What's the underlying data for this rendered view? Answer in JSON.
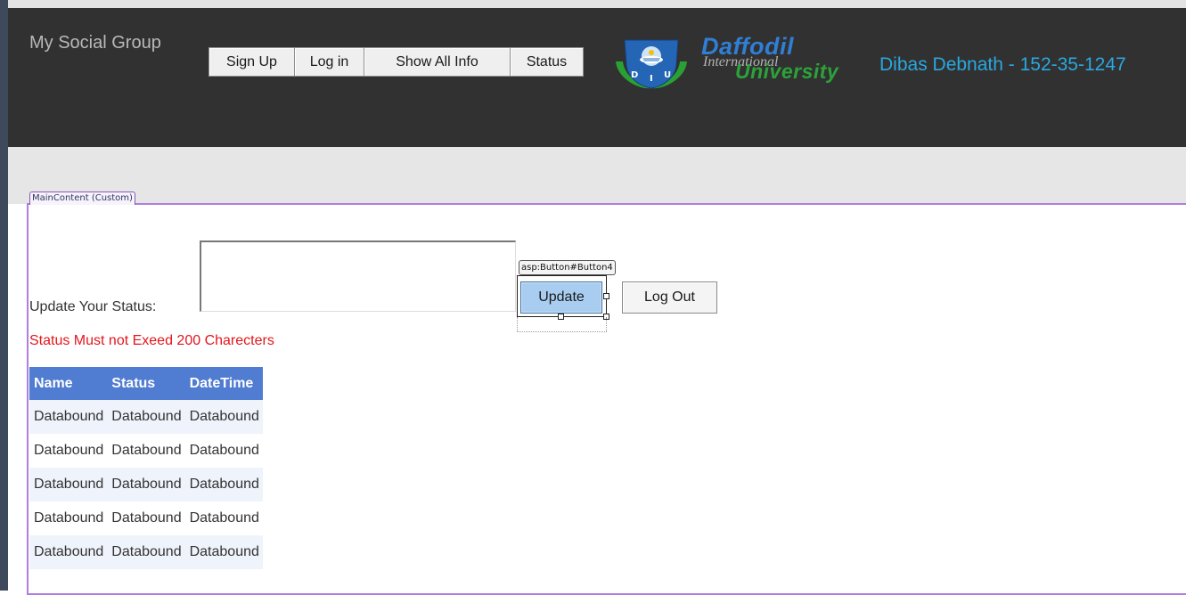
{
  "header": {
    "site_title": "My Social Group",
    "nav": [
      {
        "label": "Sign Up"
      },
      {
        "label": "Log in"
      },
      {
        "label": "Show All Info"
      },
      {
        "label": "Status"
      }
    ],
    "logo": {
      "line1": "Daffodil",
      "line2": "International",
      "line3": "University",
      "seal_text": "DIU"
    },
    "author": "Dibas Debnath - 152-35-1247"
  },
  "designer": {
    "content_tag": "MainContent (Custom)",
    "button_tag": "asp:Button#Button4"
  },
  "form": {
    "status_label": "Update Your Status:",
    "status_value": "",
    "update_label": "Update",
    "logout_label": "Log Out",
    "validator_text": "Status Must not Exeed 200 Charecters"
  },
  "grid": {
    "columns": [
      "Name",
      "Status",
      "DateTime"
    ],
    "rows": [
      [
        "Databound",
        "Databound",
        "Databound"
      ],
      [
        "Databound",
        "Databound",
        "Databound"
      ],
      [
        "Databound",
        "Databound",
        "Databound"
      ],
      [
        "Databound",
        "Databound",
        "Databound"
      ],
      [
        "Databound",
        "Databound",
        "Databound"
      ]
    ]
  },
  "colors": {
    "header_bg": "#313131",
    "author_color": "#2aa8e0",
    "grid_header_bg": "#507cd1",
    "grid_alt_row_bg": "#eff3fb",
    "validator_color": "#e3161c",
    "content_border": "#b07ee0",
    "logo_blue": "#2f7fd6",
    "logo_green": "#2ca23a"
  }
}
